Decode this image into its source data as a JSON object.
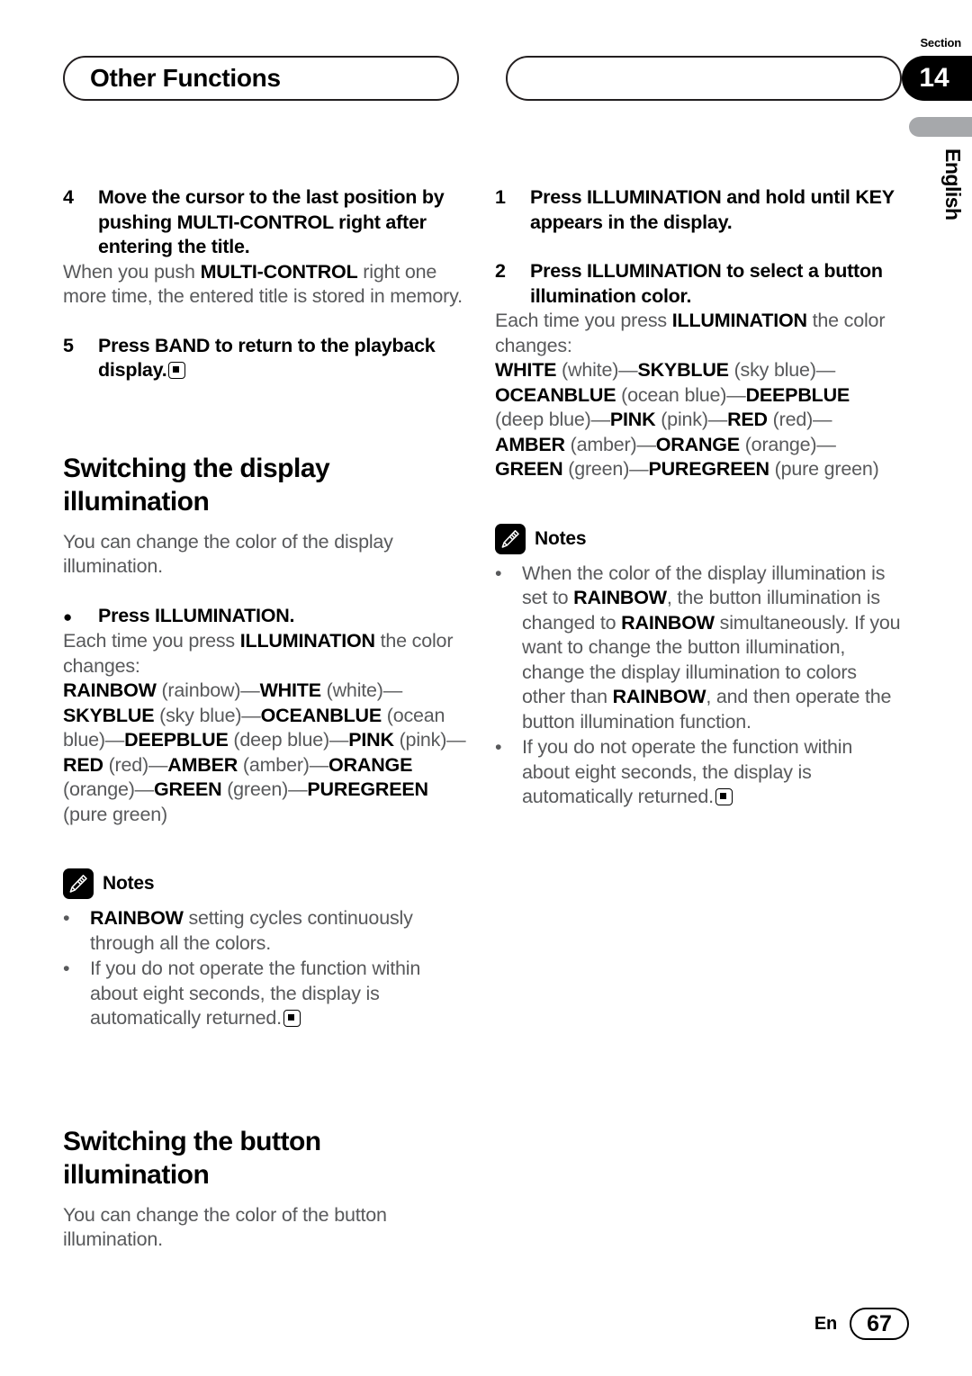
{
  "header": {
    "title": "Other Functions",
    "right_pill_title": "",
    "section_label": "Section",
    "section_number": "14",
    "language_tab": "English"
  },
  "footer": {
    "language": "En",
    "page_number": "67"
  },
  "icons": {
    "notes": "pencil-icon",
    "end_marker": "end-of-procedure-icon",
    "bullet": "●",
    "note_bullet": "•"
  },
  "left_column": {
    "step4": {
      "number": "4",
      "title": "Move the cursor to the last position by pushing MULTI-CONTROL right after entering the title.",
      "body_parts": [
        {
          "text": "When you push ",
          "bold": false
        },
        {
          "text": "MULTI-CONTROL",
          "bold": true
        },
        {
          "text": " right one more time, the entered title is stored in memory.",
          "bold": false
        }
      ]
    },
    "step5": {
      "number": "5",
      "title": "Press BAND to return to the playback display."
    },
    "heading_display": "Switching the display illumination",
    "intro_display": "You can change the color of the display illumination.",
    "bullet_press": "Press ILLUMINATION.",
    "each_time_parts": [
      {
        "text": "Each time you press ",
        "bold": false
      },
      {
        "text": "ILLUMINATION",
        "bold": true
      },
      {
        "text": " the color changes:",
        "bold": false
      }
    ],
    "color_sequence": [
      {
        "text": "RAINBOW",
        "bold": true
      },
      {
        "text": " (rainbow)—",
        "bold": false
      },
      {
        "text": "WHITE",
        "bold": true
      },
      {
        "text": " (white)—",
        "bold": false
      },
      {
        "text": "SKYBLUE",
        "bold": true
      },
      {
        "text": " (sky blue)—",
        "bold": false
      },
      {
        "text": "OCEANBLUE",
        "bold": true
      },
      {
        "text": " (ocean blue)—",
        "bold": false
      },
      {
        "text": "DEEPBLUE",
        "bold": true
      },
      {
        "text": " (deep blue)—",
        "bold": false
      },
      {
        "text": "PINK",
        "bold": true
      },
      {
        "text": " (pink)—",
        "bold": false
      },
      {
        "text": "RED",
        "bold": true
      },
      {
        "text": " (red)—",
        "bold": false
      },
      {
        "text": "AMBER",
        "bold": true
      },
      {
        "text": " (amber)—",
        "bold": false
      },
      {
        "text": "ORANGE",
        "bold": true
      },
      {
        "text": " (orange)—",
        "bold": false
      },
      {
        "text": "GREEN",
        "bold": true
      },
      {
        "text": " (green)—",
        "bold": false
      },
      {
        "text": "PUREGREEN",
        "bold": true
      },
      {
        "text": " (pure green)",
        "bold": false
      }
    ],
    "notes_label": "Notes",
    "notes": [
      [
        {
          "text": "RAINBOW",
          "bold": true
        },
        {
          "text": " setting cycles continuously through all the colors.",
          "bold": false
        }
      ],
      [
        {
          "text": "If you do not operate the function within about eight seconds, the display is automatically returned.",
          "bold": false
        }
      ]
    ],
    "heading_button": "Switching the button illumination",
    "intro_button": "You can change the color of the button illumination."
  },
  "right_column": {
    "step1": {
      "number": "1",
      "title": "Press ILLUMINATION and hold until KEY appears in the display."
    },
    "step2": {
      "number": "2",
      "title": "Press ILLUMINATION to select a button illumination color."
    },
    "each_time_parts": [
      {
        "text": "Each time you press ",
        "bold": false
      },
      {
        "text": "ILLUMINATION",
        "bold": true
      },
      {
        "text": " the color changes:",
        "bold": false
      }
    ],
    "color_sequence": [
      {
        "text": "WHITE",
        "bold": true
      },
      {
        "text": " (white)—",
        "bold": false
      },
      {
        "text": "SKYBLUE",
        "bold": true
      },
      {
        "text": " (sky blue)—",
        "bold": false
      },
      {
        "text": "OCEANBLUE",
        "bold": true
      },
      {
        "text": " (ocean blue)—",
        "bold": false
      },
      {
        "text": "DEEPBLUE",
        "bold": true
      },
      {
        "text": " (deep blue)—",
        "bold": false
      },
      {
        "text": "PINK",
        "bold": true
      },
      {
        "text": " (pink)—",
        "bold": false
      },
      {
        "text": "RED",
        "bold": true
      },
      {
        "text": " (red)—",
        "bold": false
      },
      {
        "text": "AMBER",
        "bold": true
      },
      {
        "text": " (amber)—",
        "bold": false
      },
      {
        "text": "ORANGE",
        "bold": true
      },
      {
        "text": " (orange)—",
        "bold": false
      },
      {
        "text": "GREEN",
        "bold": true
      },
      {
        "text": " (green)—",
        "bold": false
      },
      {
        "text": "PUREGREEN",
        "bold": true
      },
      {
        "text": " (pure green)",
        "bold": false
      }
    ],
    "notes_label": "Notes",
    "notes": [
      [
        {
          "text": "When the color of the display illumination is set to ",
          "bold": false
        },
        {
          "text": "RAINBOW",
          "bold": true
        },
        {
          "text": ", the button illumination is changed to ",
          "bold": false
        },
        {
          "text": "RAINBOW",
          "bold": true
        },
        {
          "text": " simultaneously. If you want to change the button illumination, change the display illumination to colors other than ",
          "bold": false
        },
        {
          "text": "RAINBOW",
          "bold": true
        },
        {
          "text": ", and then operate the button illumination function.",
          "bold": false
        }
      ],
      [
        {
          "text": "If you do not operate the function within about eight seconds, the display is automatically returned.",
          "bold": false
        }
      ]
    ]
  },
  "colors": {
    "text_body": "#58595b",
    "text_bold": "#000000",
    "tab_gray": "#a6a8ab",
    "badge_black": "#000000"
  }
}
